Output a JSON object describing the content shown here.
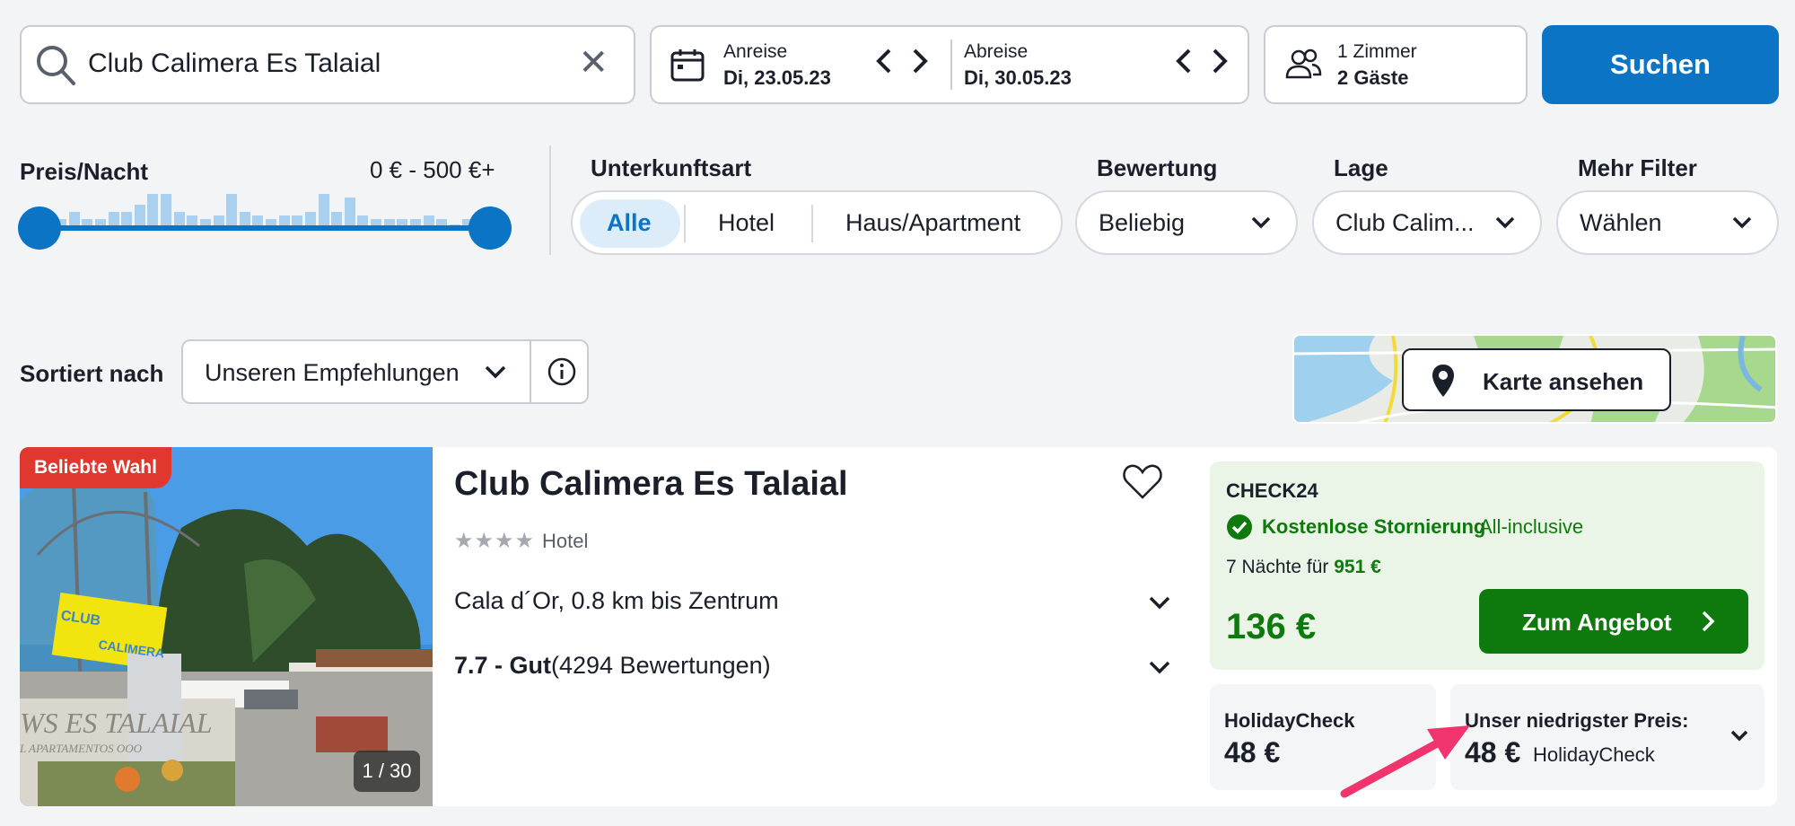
{
  "search": {
    "value": "Club Calimera Es Talaial",
    "clear_icon": "close-icon"
  },
  "dates": {
    "arrival_label": "Anreise",
    "arrival_value": "Di, 23.05.23",
    "departure_label": "Abreise",
    "departure_value": "Di, 30.05.23"
  },
  "guests": {
    "rooms": "1 Zimmer",
    "guests": "2 Gäste"
  },
  "search_button": "Suchen",
  "filters": {
    "price_label": "Preis/Nacht",
    "price_range": "0 € - 500 €+",
    "price_histogram": [
      2,
      4,
      2,
      2,
      4,
      4,
      6,
      9,
      9,
      4,
      3,
      2,
      3,
      9,
      4,
      3,
      2,
      3,
      3,
      4,
      9,
      4,
      8,
      3,
      2,
      2,
      2,
      2,
      3,
      2,
      0,
      2,
      0
    ],
    "type_label": "Unterkunftsart",
    "type_options": [
      "Alle",
      "Hotel",
      "Haus/Apartment"
    ],
    "type_selected": "Alle",
    "rating_label": "Bewertung",
    "rating_value": "Beliebig",
    "location_label": "Lage",
    "location_value": "Club Calim...",
    "more_label": "Mehr Filter",
    "more_value": "Wählen"
  },
  "sort": {
    "label": "Sortiert nach",
    "value": "Unseren Empfehlungen"
  },
  "map_button": "Karte ansehen",
  "hotel": {
    "badge": "Beliebte Wahl",
    "photo_counter": "1 / 30",
    "name": "Club Calimera Es Talaial",
    "stars": 4,
    "type": "Hotel",
    "location": "Cala d´Or, 0.8 km bis Zentrum",
    "rating_score": "7.7 - Gut",
    "rating_count": "(4294 Bewertungen)",
    "photo_text_1": "CLUB",
    "photo_text_2": "CALIMERA",
    "photo_text_3": "WS ES TALAIAL",
    "photo_text_4": "L APARTAMENTOS OOO"
  },
  "offer": {
    "provider": "CHECK24",
    "cancellation": "Kostenlose Stornierung",
    "board": "All-inclusive",
    "nights_text": "7 Nächte für",
    "nights_price": "951 €",
    "price": "136 €",
    "cta": "Zum Angebot"
  },
  "alt_offer": {
    "provider": "HolidayCheck",
    "price": "48 €"
  },
  "lowest": {
    "label": "Unser niedrigster Preis:",
    "price": "48 €",
    "provider": "HolidayCheck"
  },
  "colors": {
    "brand_blue": "#0b74c5",
    "green": "#0e7a0d",
    "badge_red": "#e0382e",
    "arrow_pink": "#f0346e"
  }
}
